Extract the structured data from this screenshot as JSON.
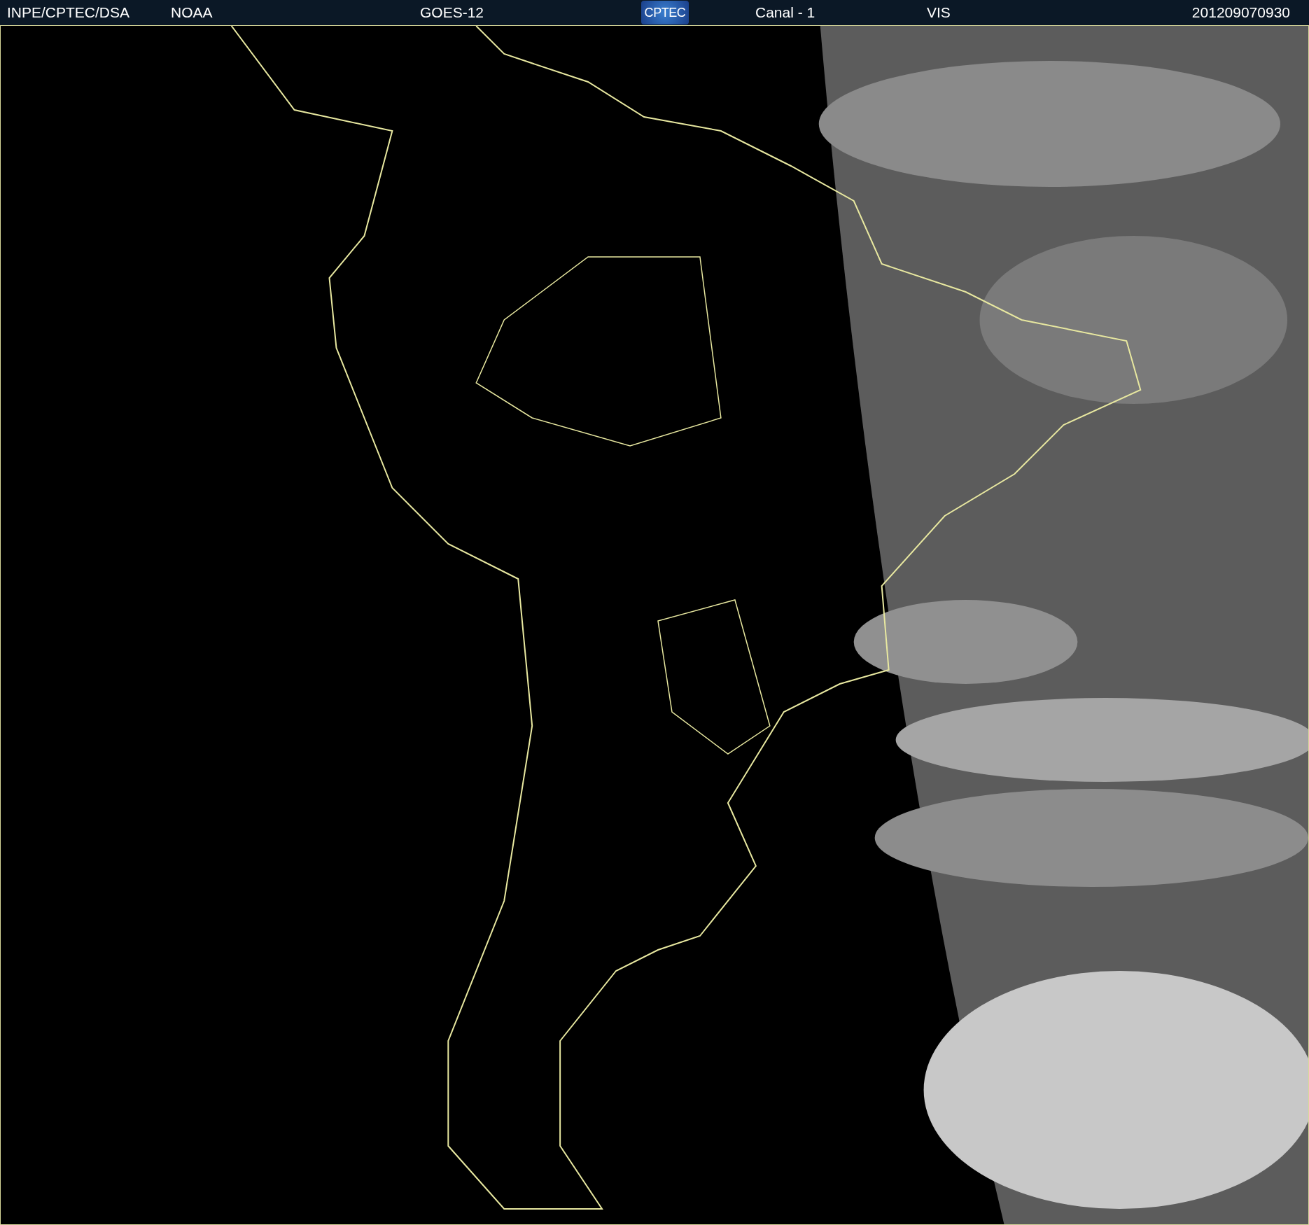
{
  "header": {
    "institution": "INPE/CPTEC/DSA",
    "agency": "NOAA",
    "satellite": "GOES-12",
    "logo": "CPTEC",
    "channel": "Canal - 1",
    "band": "VIS",
    "timestamp": "201209070930"
  }
}
